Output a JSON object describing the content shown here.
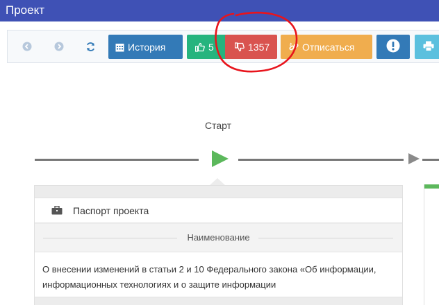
{
  "title": "Проект",
  "toolbar": {
    "history_label": "История",
    "like_count": "5",
    "dislike_count": "1357",
    "unsubscribe_label": "Отписаться"
  },
  "stage": {
    "label": "Старт"
  },
  "card": {
    "header": "Паспорт проекта",
    "field_label": "Наименование",
    "field_value": "О внесении изменений в статьи 2 и 10 Федерального закона «Об информации, информационных технологиях и о защите информации"
  },
  "colors": {
    "titlebar": "#3f51b5",
    "history": "#337ab7",
    "like": "#26b47e",
    "dislike": "#d9534f",
    "unsubscribe": "#f0ad4e",
    "play": "#5cb85c",
    "annotation": "#e8141c"
  }
}
